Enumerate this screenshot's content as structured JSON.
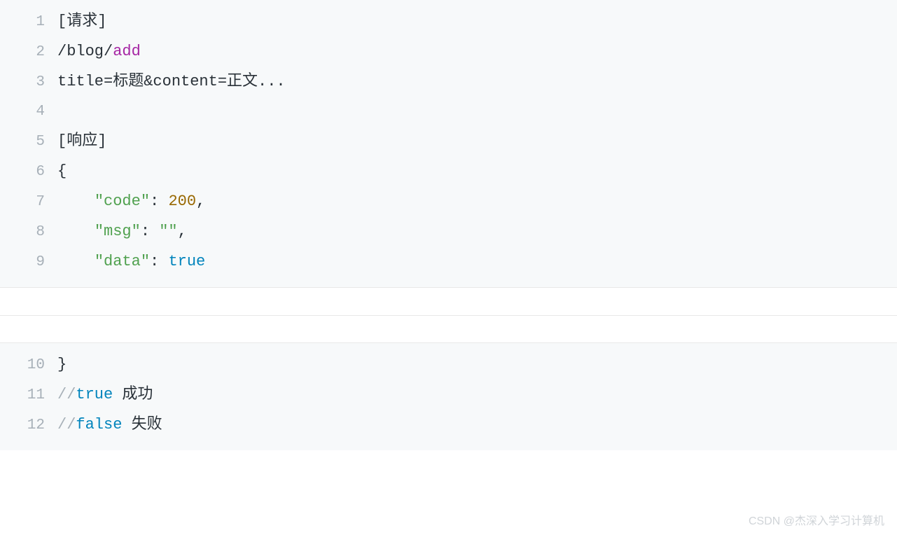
{
  "block1": {
    "lines": [
      {
        "num": "1",
        "segments": [
          {
            "text": "[请求]",
            "cls": ""
          }
        ]
      },
      {
        "num": "2",
        "segments": [
          {
            "text": "/blog/",
            "cls": "tok-path"
          },
          {
            "text": "add",
            "cls": "tok-method"
          }
        ]
      },
      {
        "num": "3",
        "segments": [
          {
            "text": "title=标题&content=正文...",
            "cls": ""
          }
        ]
      },
      {
        "num": "4",
        "segments": [
          {
            "text": "",
            "cls": ""
          }
        ]
      },
      {
        "num": "5",
        "segments": [
          {
            "text": "[响应]",
            "cls": ""
          }
        ]
      },
      {
        "num": "6",
        "segments": [
          {
            "text": "{",
            "cls": "tok-brace"
          }
        ]
      },
      {
        "num": "7",
        "segments": [
          {
            "text": "    ",
            "cls": ""
          },
          {
            "text": "\"code\"",
            "cls": "tok-string"
          },
          {
            "text": ": ",
            "cls": ""
          },
          {
            "text": "200",
            "cls": "tok-number"
          },
          {
            "text": ",",
            "cls": ""
          }
        ]
      },
      {
        "num": "8",
        "segments": [
          {
            "text": "    ",
            "cls": ""
          },
          {
            "text": "\"msg\"",
            "cls": "tok-string"
          },
          {
            "text": ": ",
            "cls": ""
          },
          {
            "text": "\"\"",
            "cls": "tok-string"
          },
          {
            "text": ",",
            "cls": ""
          }
        ]
      },
      {
        "num": "9",
        "segments": [
          {
            "text": "    ",
            "cls": ""
          },
          {
            "text": "\"data\"",
            "cls": "tok-string"
          },
          {
            "text": ": ",
            "cls": ""
          },
          {
            "text": "true",
            "cls": "tok-keyword"
          }
        ]
      }
    ]
  },
  "block2": {
    "lines": [
      {
        "num": "10",
        "segments": [
          {
            "text": "}",
            "cls": "tok-brace"
          }
        ]
      },
      {
        "num": "11",
        "segments": [
          {
            "text": "//",
            "cls": "tok-comment"
          },
          {
            "text": "true",
            "cls": "tok-keyword"
          },
          {
            "text": " 成功",
            "cls": ""
          }
        ]
      },
      {
        "num": "12",
        "segments": [
          {
            "text": "//",
            "cls": "tok-comment"
          },
          {
            "text": "false",
            "cls": "tok-keyword"
          },
          {
            "text": " 失败",
            "cls": ""
          }
        ]
      }
    ]
  },
  "watermark": "CSDN @杰深入学习计算机"
}
